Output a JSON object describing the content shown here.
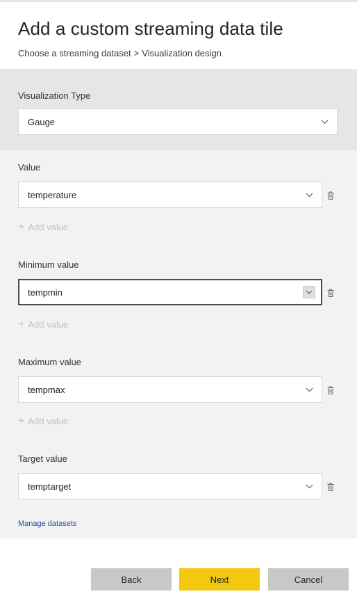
{
  "dialog": {
    "title": "Add a custom streaming data tile",
    "breadcrumb": {
      "step1": "Choose a streaming dataset",
      "separator": ">",
      "step2": "Visualization design"
    }
  },
  "viz_type": {
    "label": "Visualization Type",
    "selected": "Gauge"
  },
  "fields": {
    "value": {
      "label": "Value",
      "selected": "temperature",
      "add_label": "Add value"
    },
    "minimum": {
      "label": "Minimum value",
      "selected": "tempmin",
      "add_label": "Add value"
    },
    "maximum": {
      "label": "Maximum value",
      "selected": "tempmax",
      "add_label": "Add value"
    },
    "target": {
      "label": "Target value",
      "selected": "temptarget"
    }
  },
  "links": {
    "manage_datasets": "Manage datasets"
  },
  "buttons": {
    "back": "Back",
    "next": "Next",
    "cancel": "Cancel"
  },
  "icons": {
    "dropdown": "chevron-down-icon",
    "delete": "trash-icon",
    "add": "plus-icon"
  },
  "colors": {
    "accent_button": "#f2c811",
    "secondary_button": "#c8c8c8",
    "link": "#1f4e9e",
    "viz_panel": "#e6e6e6",
    "form_panel": "#f2f2f2"
  }
}
